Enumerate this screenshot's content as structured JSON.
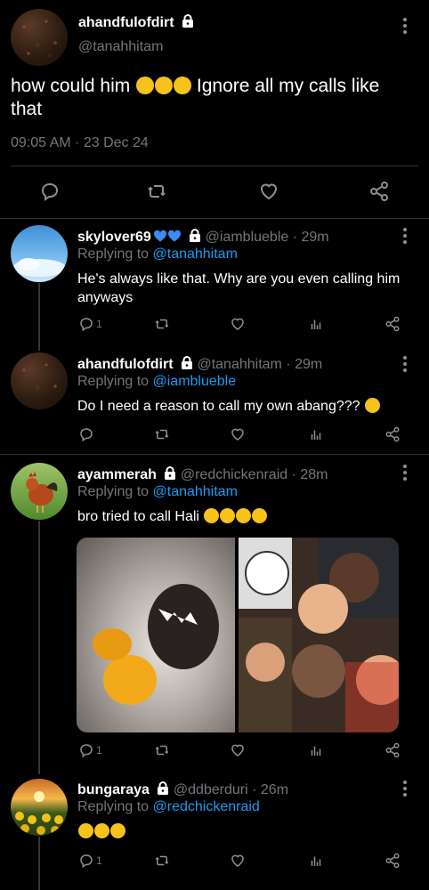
{
  "main_tweet": {
    "display_name": "ahandfulofdirt",
    "handle": "@tanahhitam",
    "text": "how could him",
    "text_after_emoji": "Ignore all my calls like that",
    "emoji": [
      "crying-face",
      "disappointed-face",
      "disappointed-face"
    ],
    "timestamp": "09:05 AM · 23 Dec 24"
  },
  "replies": [
    {
      "display_name": "skylover69",
      "handle": "@iamblueble",
      "time": "· 29m",
      "replying_prefix": "Replying to",
      "replying_to": "@tanahhitam",
      "text": "He's always like that. Why are you even calling him anyways",
      "reply_count": "1"
    },
    {
      "display_name": "ahandfulofdirt",
      "handle": "@tanahhitam",
      "time": "· 29m",
      "replying_prefix": "Replying to",
      "replying_to": "@iamblueble",
      "text": "Do I need a reason to call my own abang???",
      "reply_count": ""
    },
    {
      "display_name": "ayammerah",
      "handle": "@redchickenraid",
      "time": "· 28m",
      "replying_prefix": "Replying to",
      "replying_to": "@tanahhitam",
      "text": "bro tried to call Hali",
      "reply_count": "1"
    },
    {
      "display_name": "bungaraya",
      "handle": "@ddberduri",
      "time": "· 26m",
      "replying_prefix": "Replying to",
      "replying_to": "@redchickenraid",
      "text": "",
      "reply_count": "1"
    }
  ],
  "icons": {
    "reply": "reply-icon",
    "retweet": "retweet-icon",
    "like": "heart-icon",
    "analytics": "analytics-icon",
    "share": "share-icon",
    "more": "more-vertical-icon",
    "lock": "lock-icon"
  },
  "colors": {
    "background": "#000000",
    "text": "#e7e9ea",
    "muted": "#71767b",
    "link": "#1d9bf0",
    "divider": "#2f3336"
  }
}
